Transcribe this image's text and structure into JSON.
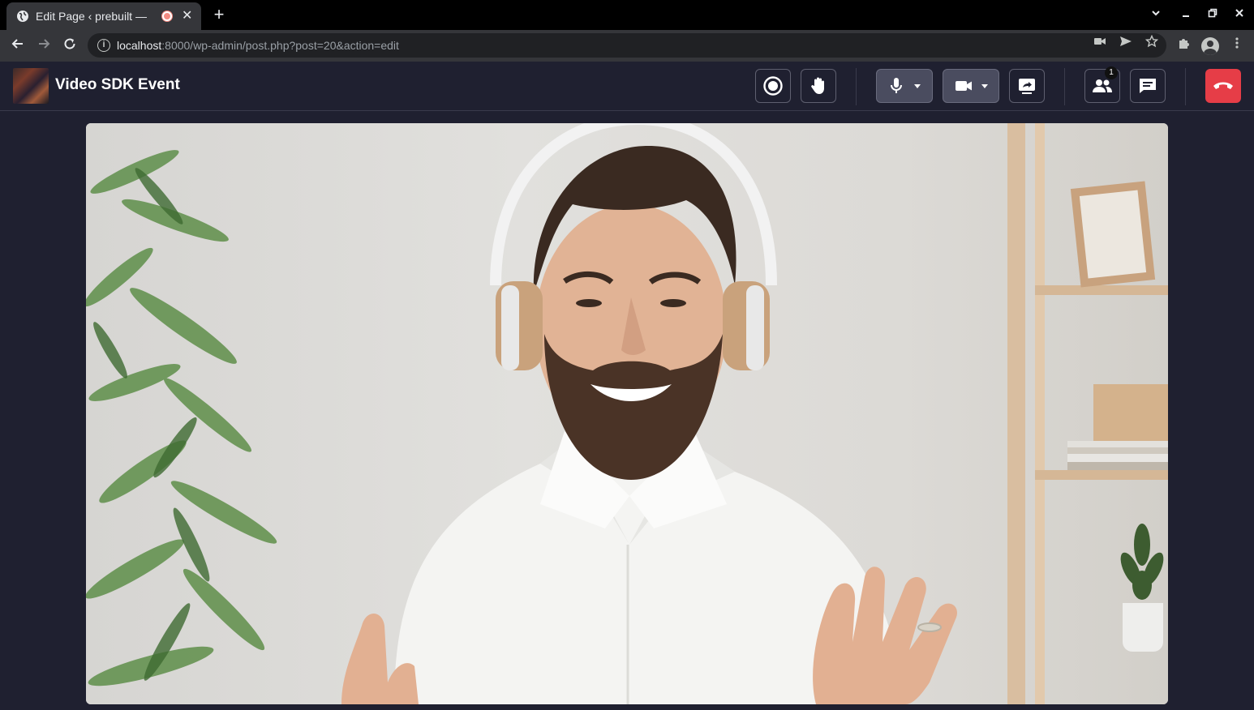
{
  "browser": {
    "tab_title": "Edit Page ‹ prebuilt —",
    "tab_close": "✕",
    "new_tab": "+",
    "url_host": "localhost",
    "url_path": ":8000/wp-admin/post.php?post=20&action=edit"
  },
  "app": {
    "title": "Video SDK Event",
    "participants_count": "1",
    "accent_end_call": "#e63d47",
    "background": "#1f2030"
  },
  "controls": [
    {
      "name": "record-button",
      "icon": "record-icon"
    },
    {
      "name": "raise-hand-button",
      "icon": "hand-icon"
    },
    {
      "name": "mic-button",
      "icon": "mic-icon"
    },
    {
      "name": "camera-button",
      "icon": "video-camera-icon"
    },
    {
      "name": "screen-share-button",
      "icon": "screen-share-icon"
    },
    {
      "name": "participants-button",
      "icon": "people-icon"
    },
    {
      "name": "chat-button",
      "icon": "chat-icon"
    },
    {
      "name": "end-call-button",
      "icon": "phone-hangup-icon"
    }
  ]
}
